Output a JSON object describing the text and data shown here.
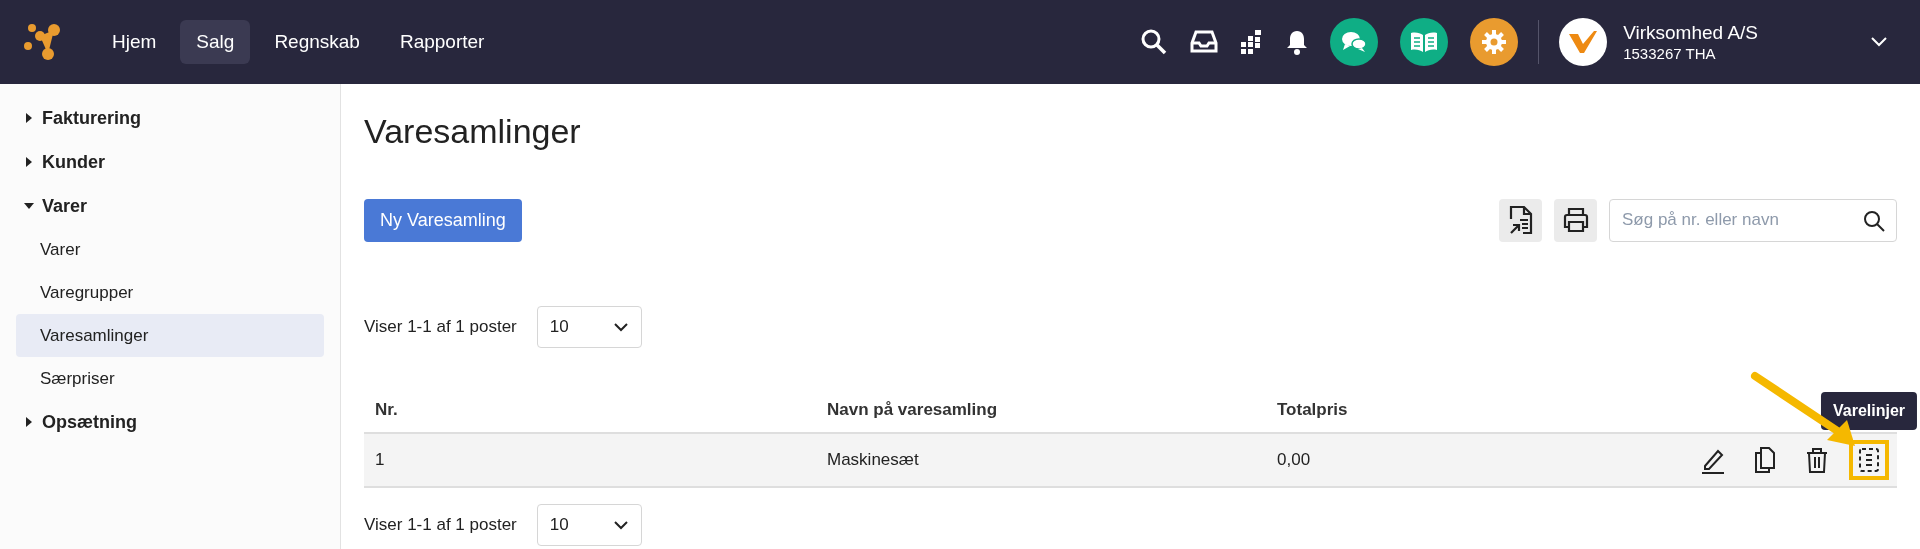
{
  "nav": {
    "items": [
      {
        "label": "Hjem",
        "selected": false
      },
      {
        "label": "Salg",
        "selected": true
      },
      {
        "label": "Regnskab",
        "selected": false
      },
      {
        "label": "Rapporter",
        "selected": false
      }
    ],
    "company": {
      "name": "Virksomhed A/S",
      "id": "1533267 THA"
    }
  },
  "sidebar": [
    {
      "label": "Fakturering",
      "expanded": false
    },
    {
      "label": "Kunder",
      "expanded": false
    },
    {
      "label": "Varer",
      "expanded": true,
      "children": [
        {
          "label": "Varer",
          "selected": false
        },
        {
          "label": "Varegrupper",
          "selected": false
        },
        {
          "label": "Varesamlinger",
          "selected": true
        },
        {
          "label": "Særpriser",
          "selected": false
        }
      ]
    },
    {
      "label": "Opsætning",
      "expanded": false
    }
  ],
  "page": {
    "title": "Varesamlinger",
    "new_button": "Ny Varesamling",
    "search": {
      "placeholder": "Søg på nr. eller navn"
    },
    "pager_top": {
      "text": "Viser 1-1 af 1 poster",
      "page_size": "10"
    },
    "table": {
      "columns": [
        "Nr.",
        "Navn på varesamling",
        "Totalpris"
      ],
      "rows": [
        {
          "cells": [
            "1",
            "Maskinesæt",
            "0,00"
          ],
          "actions": [
            {
              "kind": "edit",
              "highlighted": false
            },
            {
              "kind": "copy",
              "highlighted": false
            },
            {
              "kind": "delete",
              "highlighted": false
            },
            {
              "kind": "lines",
              "highlighted": true,
              "tooltip": "Varelinjer"
            }
          ]
        }
      ]
    },
    "pager_bottom": {
      "text": "Viser 1-1 af 1 poster",
      "page_size": "10"
    }
  }
}
